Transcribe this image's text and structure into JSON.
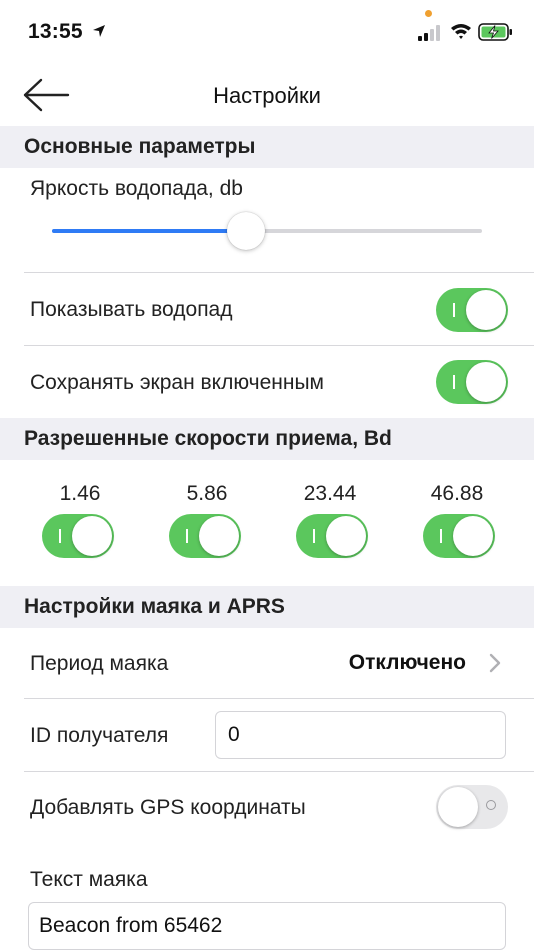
{
  "status_bar": {
    "time": "13:55"
  },
  "nav": {
    "title": "Настройки"
  },
  "sections": {
    "main": "Основные параметры",
    "speeds": "Разрешенные скорости приема, Bd",
    "beacon": "Настройки маяка и APRS"
  },
  "main": {
    "brightness_label": "Яркость водопада, db",
    "brightness_fraction": 0.45,
    "show_waterfall_label": "Показывать водопад",
    "show_waterfall_on": true,
    "keep_screen_label": "Сохранять экран включенным",
    "keep_screen_on": true
  },
  "speeds": {
    "items": [
      {
        "label": "1.46",
        "on": true
      },
      {
        "label": "5.86",
        "on": true
      },
      {
        "label": "23.44",
        "on": true
      },
      {
        "label": "46.88",
        "on": true
      }
    ]
  },
  "beacon": {
    "period_label": "Период маяка",
    "period_value": "Отключено",
    "recipient_label": "ID получателя",
    "recipient_value": "0",
    "gps_label": "Добавлять GPS координаты",
    "gps_on": false,
    "text_label": "Текст маяка",
    "text_value": "Beacon from 65462"
  },
  "colors": {
    "accent": "#2f7bf5",
    "switch_on": "#5bc75d",
    "section_bg": "#efeff4"
  }
}
